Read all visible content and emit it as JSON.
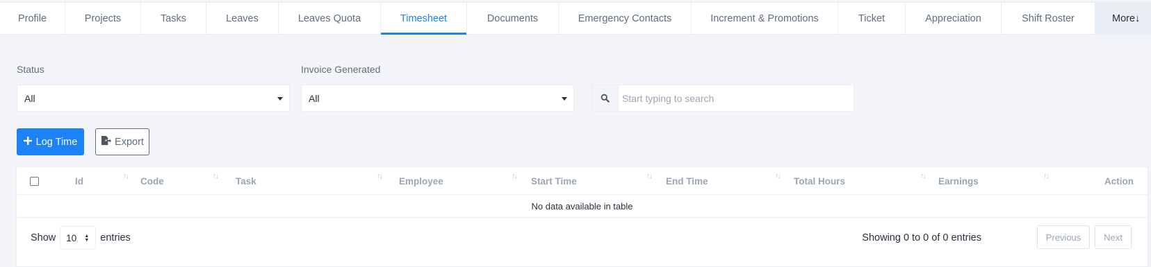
{
  "tabs": [
    {
      "label": "Profile",
      "active": false
    },
    {
      "label": "Projects",
      "active": false
    },
    {
      "label": "Tasks",
      "active": false
    },
    {
      "label": "Leaves",
      "active": false
    },
    {
      "label": "Leaves Quota",
      "active": false
    },
    {
      "label": "Timesheet",
      "active": true
    },
    {
      "label": "Documents",
      "active": false
    },
    {
      "label": "Emergency Contacts",
      "active": false
    },
    {
      "label": "Increment & Promotions",
      "active": false
    },
    {
      "label": "Ticket",
      "active": false
    },
    {
      "label": "Appreciation",
      "active": false
    },
    {
      "label": "Shift Roster",
      "active": false
    }
  ],
  "more_tab": "More↓",
  "filters": {
    "status": {
      "label": "Status",
      "value": "All"
    },
    "invoice": {
      "label": "Invoice Generated",
      "value": "All"
    },
    "search": {
      "placeholder": "Start typing to search",
      "value": ""
    }
  },
  "actions": {
    "log_time": "Log Time",
    "export": "Export"
  },
  "table": {
    "columns": [
      "Id",
      "Code",
      "Task",
      "Employee",
      "Start Time",
      "End Time",
      "Total Hours",
      "Earnings",
      "Action"
    ],
    "empty_message": "No data available in table"
  },
  "footer": {
    "show_label": "Show",
    "page_length": "10",
    "entries_label": "entries",
    "info": "Showing 0 to 0 of 0 entries",
    "previous": "Previous",
    "next": "Next"
  },
  "colors": {
    "accent": "#1d82f5",
    "muted_text": "#99a5b5",
    "background": "#f2f4f7"
  }
}
